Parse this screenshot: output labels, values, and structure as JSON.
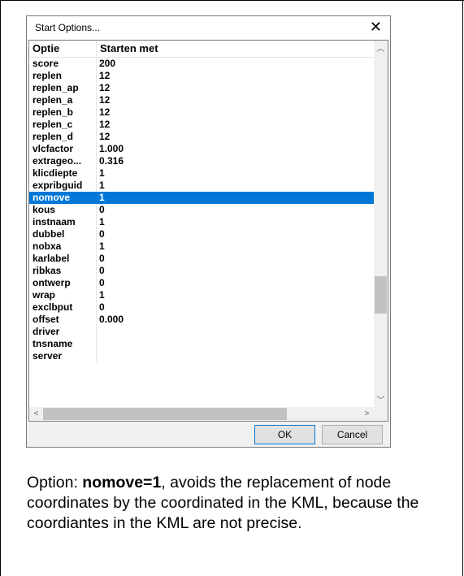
{
  "dialog": {
    "title": "Start Options...",
    "close_glyph": "✕",
    "columns": [
      "Optie",
      "Starten met"
    ],
    "rows": [
      {
        "name": "score",
        "value": "200"
      },
      {
        "name": "replen",
        "value": "12"
      },
      {
        "name": "replen_ap",
        "value": "12"
      },
      {
        "name": "replen_a",
        "value": "12"
      },
      {
        "name": "replen_b",
        "value": "12"
      },
      {
        "name": "replen_c",
        "value": "12"
      },
      {
        "name": "replen_d",
        "value": "12"
      },
      {
        "name": "vlcfactor",
        "value": "1.000"
      },
      {
        "name": "extrageo...",
        "value": "0.316"
      },
      {
        "name": "klicdiepte",
        "value": "1"
      },
      {
        "name": "expribguid",
        "value": "1"
      },
      {
        "name": "nomove",
        "value": "1",
        "selected": true
      },
      {
        "name": "kous",
        "value": "0"
      },
      {
        "name": "instnaam",
        "value": "1"
      },
      {
        "name": "dubbel",
        "value": "0"
      },
      {
        "name": "nobxa",
        "value": "1"
      },
      {
        "name": "karlabel",
        "value": "0"
      },
      {
        "name": "ribkas",
        "value": "0"
      },
      {
        "name": "ontwerp",
        "value": "0"
      },
      {
        "name": "wrap",
        "value": "1"
      },
      {
        "name": "exclbput",
        "value": "0"
      },
      {
        "name": "offset",
        "value": "0.000"
      },
      {
        "name": "driver",
        "value": ""
      },
      {
        "name": "tnsname",
        "value": ""
      },
      {
        "name": "server",
        "value": ""
      }
    ],
    "ok_label": "OK",
    "cancel_label": "Cancel"
  },
  "caption": {
    "prefix": "Option: ",
    "bold": "nomove=1",
    "rest": ", avoids the replacement of node coordinates by the coordinated in the KML, because the coordiantes in the KML are not precise."
  },
  "colors": {
    "selection": "#0078d7"
  }
}
